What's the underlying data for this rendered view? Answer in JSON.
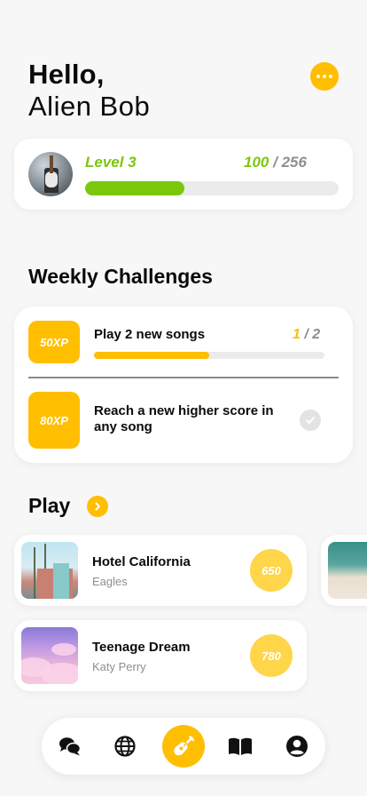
{
  "header": {
    "greeting": "Hello,",
    "name": "Alien Bob",
    "more_icon": "more-horizontal-icon"
  },
  "level": {
    "label": "Level 3",
    "xp_current": "100",
    "xp_separator": "/",
    "xp_max": "256",
    "progress": 0.39,
    "color": "#7ac70c"
  },
  "weekly": {
    "title": "Weekly Challenges",
    "challenges": [
      {
        "xp": "50XP",
        "title": "Play 2 new songs",
        "progress_current": "1",
        "progress_sep": "/",
        "progress_total": "2",
        "progress": 0.5
      },
      {
        "xp": "80XP",
        "title": "Reach a new higher score in any song",
        "completed": true
      }
    ]
  },
  "play": {
    "title": "Play",
    "songs": [
      {
        "title": "Hotel California",
        "artist": "Eagles",
        "score": "650"
      },
      {
        "title": "Teenage Dream",
        "artist": "Katy Perry",
        "score": "780"
      }
    ]
  },
  "nav": {
    "items": [
      "chat-icon",
      "globe-icon",
      "guitar-icon",
      "book-icon",
      "profile-icon"
    ],
    "active": "guitar-icon"
  },
  "colors": {
    "accent": "#ffbe00",
    "green": "#7ac70c",
    "background": "#f7f7f7"
  }
}
